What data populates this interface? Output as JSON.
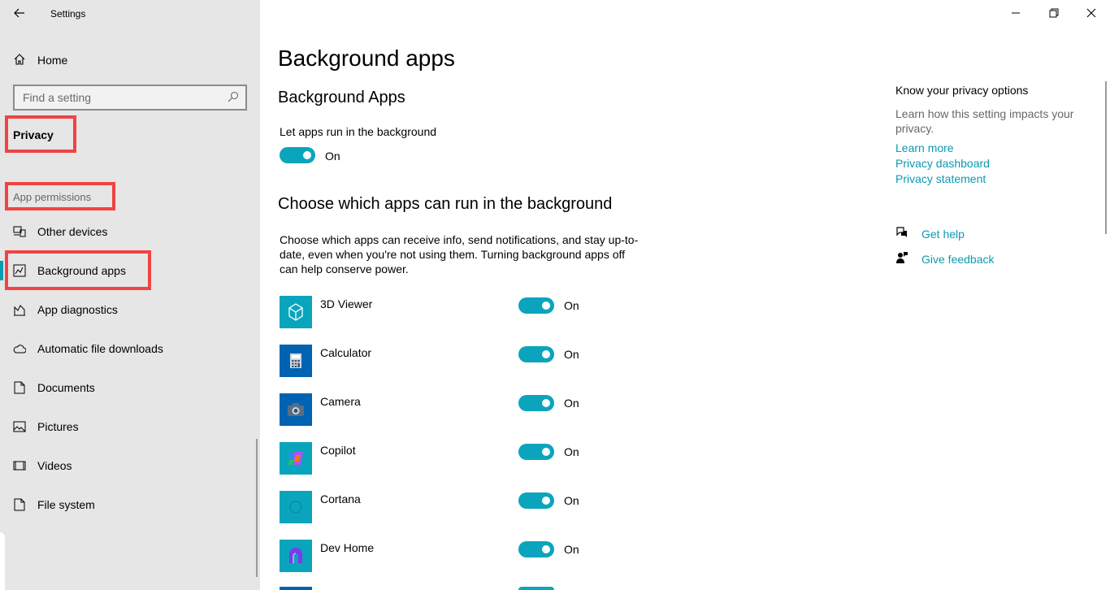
{
  "window": {
    "title": "Settings"
  },
  "sidebar": {
    "home_label": "Home",
    "search_placeholder": "Find a setting",
    "section_title": "Privacy",
    "group_label": "App permissions",
    "items": [
      {
        "label": "Other devices",
        "icon": "devices-icon"
      },
      {
        "label": "Background apps",
        "icon": "background-apps-icon"
      },
      {
        "label": "App diagnostics",
        "icon": "diagnostics-icon"
      },
      {
        "label": "Automatic file downloads",
        "icon": "cloud-icon"
      },
      {
        "label": "Documents",
        "icon": "document-icon"
      },
      {
        "label": "Pictures",
        "icon": "picture-icon"
      },
      {
        "label": "Videos",
        "icon": "video-icon"
      },
      {
        "label": "File system",
        "icon": "file-icon"
      }
    ],
    "active_item": "Background apps"
  },
  "main": {
    "page_title": "Background apps",
    "section1_title": "Background Apps",
    "let_apps_label": "Let apps run in the background",
    "master_toggle_state": "On",
    "section2_title": "Choose which apps can run in the background",
    "description": "Choose which apps can receive info, send notifications, and stay up-to-date, even when you're not using them. Turning background apps off can help conserve power.",
    "apps": [
      {
        "name": "3D Viewer",
        "state": "On",
        "icon": "3d-viewer-icon",
        "color": "#0aa5bd"
      },
      {
        "name": "Calculator",
        "state": "On",
        "icon": "calculator-icon",
        "color": "#0063b1"
      },
      {
        "name": "Camera",
        "state": "On",
        "icon": "camera-icon",
        "color": "#0063b1"
      },
      {
        "name": "Copilot",
        "state": "On",
        "icon": "copilot-icon",
        "color": "#0aa5bd"
      },
      {
        "name": "Cortana",
        "state": "On",
        "icon": "cortana-icon",
        "color": "#0aa5bd"
      },
      {
        "name": "Dev Home",
        "state": "On",
        "icon": "dev-home-icon",
        "color": "#0aa5bd"
      }
    ]
  },
  "right": {
    "heading": "Know your privacy options",
    "body": "Learn how this setting impacts your privacy.",
    "links": [
      "Learn more",
      "Privacy dashboard",
      "Privacy statement"
    ],
    "get_help": "Get help",
    "give_feedback": "Give feedback"
  },
  "colors": {
    "accent": "#0aa5bd",
    "sidebar_bg": "#e6e6e6",
    "highlight": "#ef4444"
  }
}
